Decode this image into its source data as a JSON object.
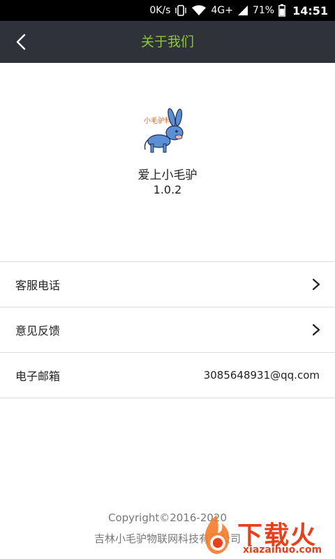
{
  "status_bar": {
    "net_speed": "0K/s",
    "network": "4G+",
    "battery": "71%",
    "time": "14:51"
  },
  "nav": {
    "title": "关于我们",
    "back_icon": "chevron-left-icon"
  },
  "app": {
    "name": "爱上小毛驴",
    "version": "1.0.2",
    "logo_text": "小毛驴科技"
  },
  "list": [
    {
      "label": "客服电话",
      "value": "",
      "chevron": true
    },
    {
      "label": "意见反馈",
      "value": "",
      "chevron": true
    },
    {
      "label": "电子邮箱",
      "value": "3085648931@qq.com",
      "chevron": false
    }
  ],
  "footer": {
    "copyright": "Copyright©2016-2020",
    "company": "吉林小毛驴物联网科技有限公司"
  },
  "watermark": {
    "text": "下载火",
    "url": "xiazaihuo.com"
  },
  "colors": {
    "nav_bg": "#2f3238",
    "accent": "#8cc63f",
    "watermark": "#e8401c"
  }
}
